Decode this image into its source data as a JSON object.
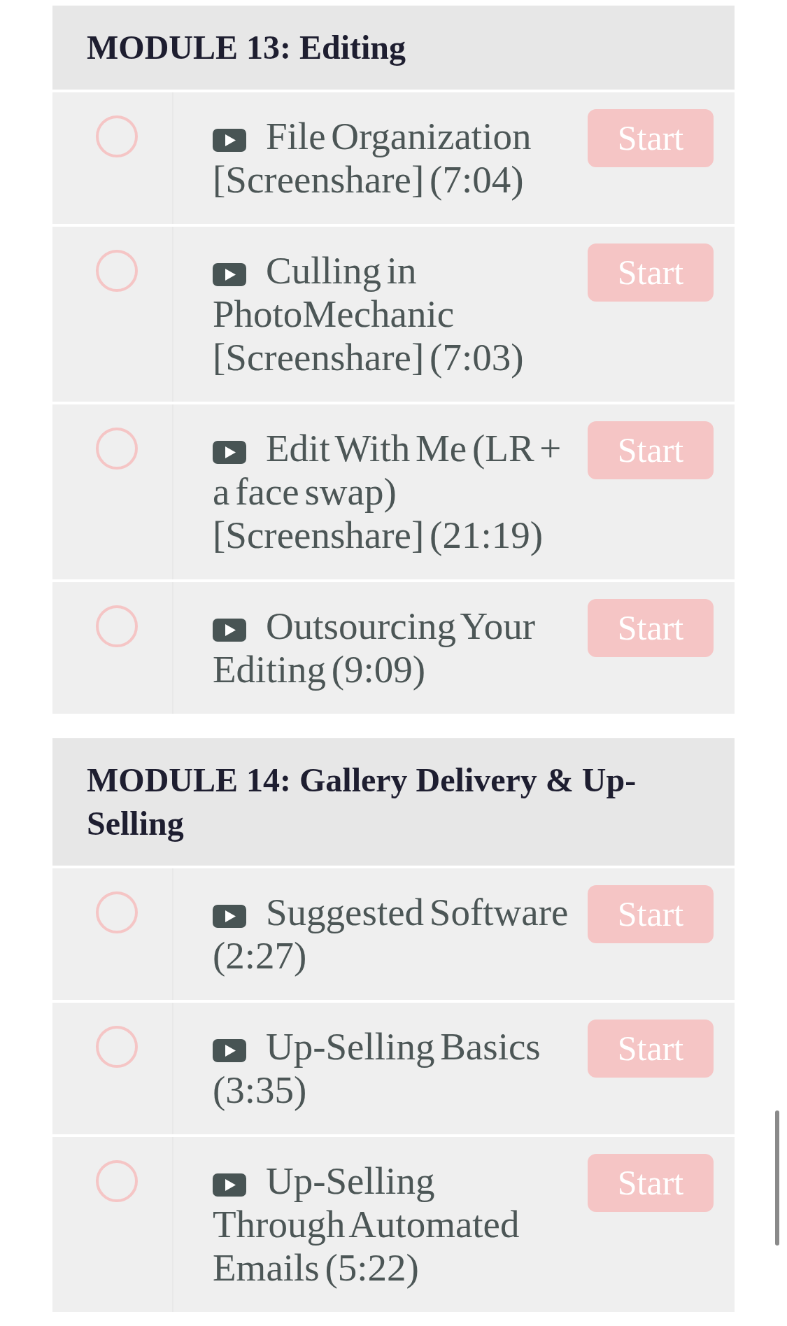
{
  "modules": [
    {
      "title": "MODULE 13: Editing",
      "lessons": [
        {
          "title": "File Organization [Screenshare] (7:04)",
          "completed": false,
          "button": "Start"
        },
        {
          "title": "Culling in PhotoMechanic [Screenshare] (7:03)",
          "completed": false,
          "button": "Start"
        },
        {
          "title": "Edit With Me (LR + a face swap) [Screenshare] (21:19)",
          "completed": false,
          "button": "Start"
        },
        {
          "title": "Outsourcing Your Editing (9:09)",
          "completed": false,
          "button": "Start"
        }
      ]
    },
    {
      "title": "MODULE 14: Gallery Delivery & Up-Selling",
      "lessons": [
        {
          "title": "Suggested Software (2:27)",
          "completed": false,
          "button": "Start"
        },
        {
          "title": "Up-Selling Basics (3:35)",
          "completed": false,
          "button": "Start"
        },
        {
          "title": "Up-Selling Through Automated Emails (5:22)",
          "completed": false,
          "button": "Start"
        }
      ]
    }
  ]
}
